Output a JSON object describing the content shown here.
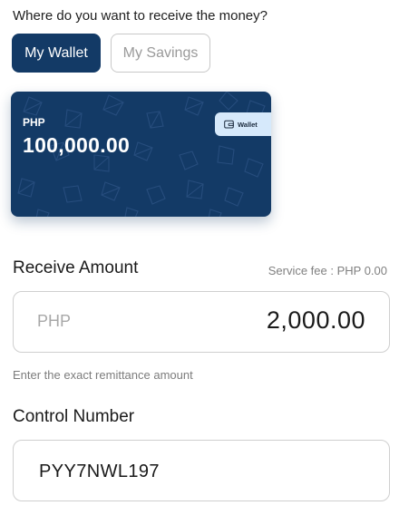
{
  "receive": {
    "question": "Where do you want to receive the money?",
    "options": [
      {
        "label": "My Wallet",
        "selected": true
      },
      {
        "label": "My Savings",
        "selected": false
      }
    ]
  },
  "wallet_card": {
    "currency": "PHP",
    "balance": "100,000.00",
    "tag_label": "Wallet",
    "tag_icon": "wallet-icon",
    "background_color": "#133a66"
  },
  "amount": {
    "title": "Receive Amount",
    "service_fee": "Service fee : PHP 0.00",
    "currency": "PHP",
    "value": "2,000.00",
    "hint": "Enter the exact remittance amount"
  },
  "control": {
    "title": "Control Number",
    "value": "PYY7NWL197"
  },
  "colors": {
    "primary": "#133a66",
    "chip": "#d6e9fb",
    "border": "#cfcfcf"
  }
}
